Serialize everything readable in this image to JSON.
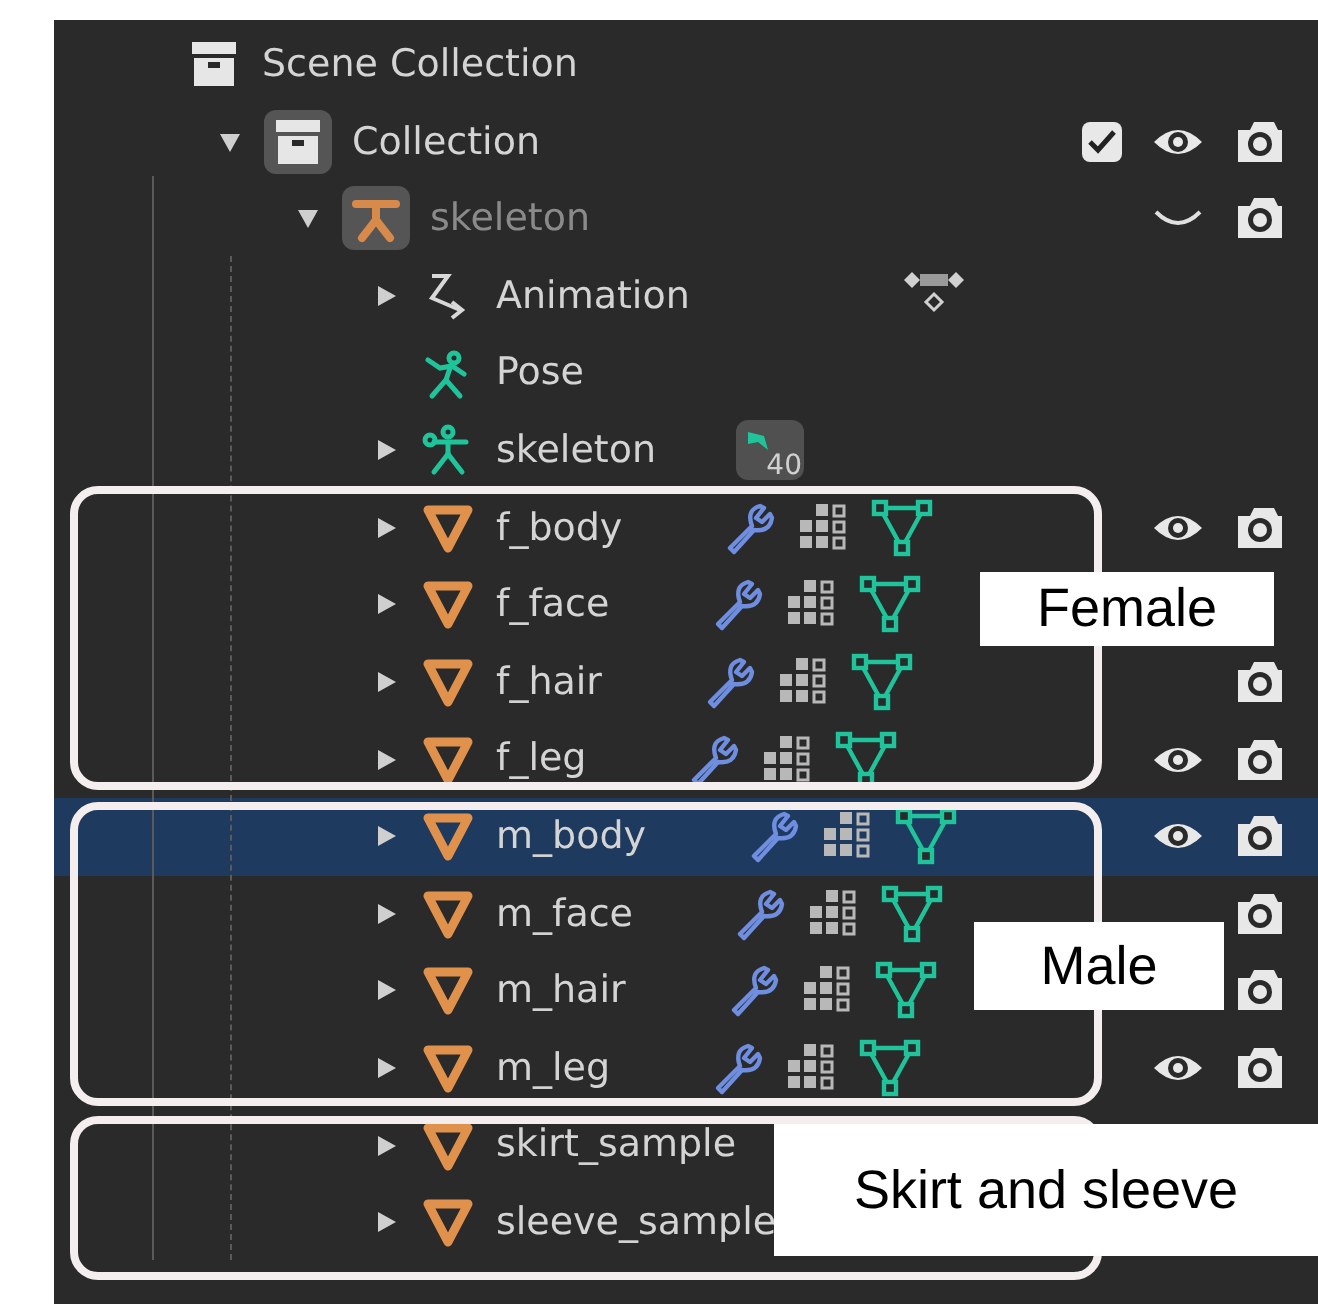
{
  "outliner": {
    "tree": [
      {
        "name": "Scene Collection",
        "kind": "collection",
        "children": [
          {
            "name": "Collection",
            "kind": "collection",
            "expanded": true,
            "icon_active": true,
            "checked": true,
            "visible": true,
            "renderable": true,
            "children": [
              {
                "name": "skeleton",
                "kind": "armature_object",
                "expanded": true,
                "icon_active": true,
                "dimmed": true,
                "visible": false,
                "renderable": true,
                "children": [
                  {
                    "name": "Animation",
                    "kind": "action",
                    "expanded": false
                  },
                  {
                    "name": "Pose",
                    "kind": "pose"
                  },
                  {
                    "name": "skeleton",
                    "kind": "armature",
                    "expanded": false,
                    "count": "40"
                  },
                  {
                    "name": "f_body",
                    "kind": "mesh",
                    "expanded": false,
                    "selected": false,
                    "modifier_icons": true,
                    "visible": true,
                    "renderable": true
                  },
                  {
                    "name": "f_face",
                    "kind": "mesh",
                    "expanded": false,
                    "selected": false,
                    "modifier_icons": true
                  },
                  {
                    "name": "f_hair",
                    "kind": "mesh",
                    "expanded": false,
                    "selected": false,
                    "modifier_icons": true,
                    "renderable": true
                  },
                  {
                    "name": "f_leg",
                    "kind": "mesh",
                    "expanded": false,
                    "selected": false,
                    "modifier_icons": true,
                    "visible": true,
                    "renderable": true
                  },
                  {
                    "name": "m_body",
                    "kind": "mesh",
                    "expanded": false,
                    "selected": true,
                    "modifier_icons": true,
                    "visible": true,
                    "renderable": true
                  },
                  {
                    "name": "m_face",
                    "kind": "mesh",
                    "expanded": false,
                    "selected": false,
                    "modifier_icons": true,
                    "renderable": true
                  },
                  {
                    "name": "m_hair",
                    "kind": "mesh",
                    "expanded": false,
                    "selected": false,
                    "modifier_icons": true,
                    "renderable": true
                  },
                  {
                    "name": "m_leg",
                    "kind": "mesh",
                    "expanded": false,
                    "selected": false,
                    "modifier_icons": true,
                    "visible": true,
                    "renderable": true
                  },
                  {
                    "name": "skirt_sample",
                    "kind": "mesh",
                    "expanded": false,
                    "selected": false
                  },
                  {
                    "name": "sleeve_sample",
                    "kind": "mesh",
                    "expanded": false,
                    "selected": false
                  }
                ]
              }
            ]
          }
        ]
      }
    ]
  },
  "annotations": [
    {
      "label": "Female"
    },
    {
      "label": "Male"
    },
    {
      "label": "Skirt and sleeve"
    }
  ]
}
